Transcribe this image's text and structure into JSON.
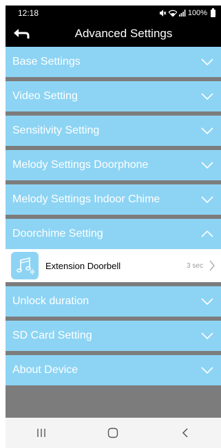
{
  "status_bar": {
    "time": "12:18",
    "battery": "100%"
  },
  "header": {
    "title": "Advanced Settings",
    "back_icon": "back-arrow-icon"
  },
  "menu": [
    {
      "label": "Base Settings",
      "expanded": false
    },
    {
      "label": "Video Setting",
      "expanded": false
    },
    {
      "label": "Sensitivity Setting",
      "expanded": false
    },
    {
      "label": "Melody Settings Doorphone",
      "expanded": false
    },
    {
      "label": "Melody Settings Indoor Chime",
      "expanded": false
    },
    {
      "label": "Doorchime Setting",
      "expanded": true
    },
    {
      "label": "Unlock duration",
      "expanded": false
    },
    {
      "label": "SD Card Setting",
      "expanded": false
    },
    {
      "label": "About Device",
      "expanded": false
    }
  ],
  "doorchime": {
    "item_label": "Extension Doorbell",
    "item_value": "3 sec",
    "icon": "music-note-icon"
  },
  "colors": {
    "accent": "#8dd4f4",
    "header": "#000000",
    "separator": "#7c7c7c",
    "nav_bar": "#f4f4f4"
  },
  "nav_bar": {
    "recent_icon": "recent-apps-icon",
    "home_icon": "home-icon",
    "back_icon": "nav-back-icon"
  }
}
